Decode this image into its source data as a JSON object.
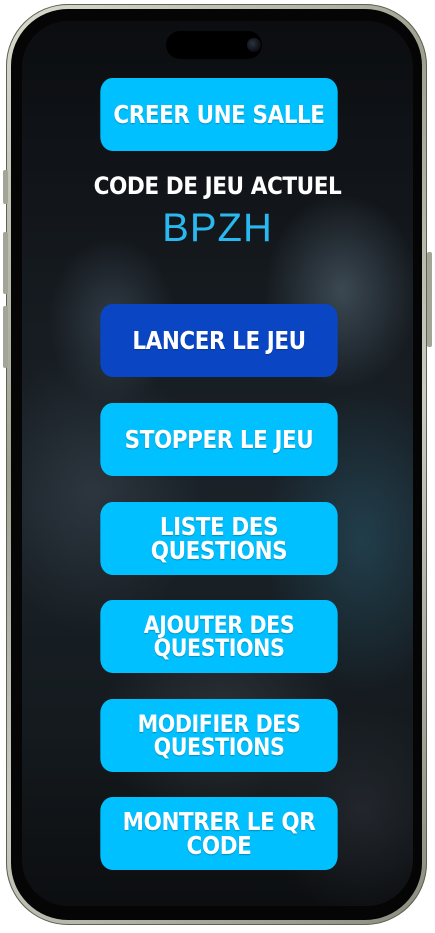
{
  "room": {
    "create_label": "CREER UNE SALLE",
    "code_label": "CODE DE JEU ACTUEL",
    "code_value": "BPZH"
  },
  "menu": {
    "start_label": "LANCER LE JEU",
    "stop_label": "STOPPER LE JEU",
    "list_questions_label": "LISTE DES QUESTIONS",
    "add_questions_label": "AJOUTER DES QUESTIONS",
    "edit_questions_label": "MODIFIER DES QUESTIONS",
    "show_qr_label": "MONTRER LE QR CODE"
  },
  "colors": {
    "button_primary": "#00c0ff",
    "button_active": "#0a46c4",
    "code_value": "#29b9f0"
  }
}
